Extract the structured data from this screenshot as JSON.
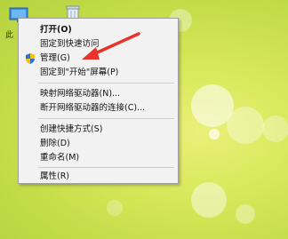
{
  "desktop": {
    "icons": [
      {
        "name": "computer-desktop-icon",
        "label": "此"
      },
      {
        "name": "recycle-bin-icon"
      }
    ]
  },
  "context_menu": {
    "items": [
      {
        "label": "打开(O)",
        "bold": true
      },
      {
        "label": "固定到快速访问"
      },
      {
        "label": "管理(G)",
        "icon": "shield-icon"
      },
      {
        "label": "固定到\"开始\"屏幕(P)"
      },
      {
        "label": "映射网络驱动器(N)..."
      },
      {
        "label": "断开网络驱动器的连接(C)..."
      },
      {
        "label": "创建快捷方式(S)"
      },
      {
        "label": "删除(D)"
      },
      {
        "label": "重命名(M)"
      },
      {
        "label": "属性(R)"
      }
    ]
  },
  "annotation": {
    "color": "#e8322b"
  }
}
